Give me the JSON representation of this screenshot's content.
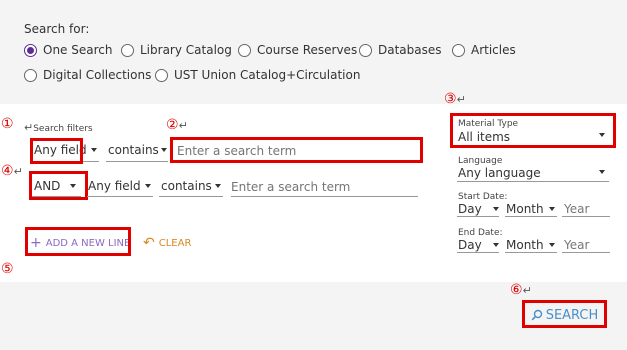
{
  "scope": {
    "title": "Search for:",
    "options": [
      {
        "label": "One Search",
        "selected": true
      },
      {
        "label": "Library Catalog",
        "selected": false
      },
      {
        "label": "Course Reserves",
        "selected": false
      },
      {
        "label": "Databases",
        "selected": false
      },
      {
        "label": "Articles",
        "selected": false
      },
      {
        "label": "Digital Collections",
        "selected": false
      },
      {
        "label": "UST Union Catalog+Circulation",
        "selected": false
      }
    ]
  },
  "markers": {
    "m1": "①",
    "m2": "②",
    "m3": "③",
    "m4": "④",
    "m5": "⑤",
    "m6": "⑥",
    "return_symbol": "↵"
  },
  "filters": {
    "label": "Search filters",
    "row1": {
      "field": "Any field",
      "operator": "contains",
      "placeholder": "Enter a search term"
    },
    "row2": {
      "boolean": "AND",
      "field": "Any field",
      "operator": "contains",
      "placeholder": "Enter a search term"
    },
    "add_line": "ADD A NEW LINE",
    "clear": "CLEAR"
  },
  "facets": {
    "material_type": {
      "label": "Material Type",
      "value": "All items"
    },
    "language": {
      "label": "Language",
      "value": "Any language"
    },
    "start_date": {
      "label": "Start Date:",
      "day": "Day",
      "month": "Month",
      "year": "Year"
    },
    "end_date": {
      "label": "End Date:",
      "day": "Day",
      "month": "Month",
      "year": "Year"
    }
  },
  "search_button": {
    "label": "SEARCH"
  },
  "colors": {
    "accent": "#5c2d91",
    "annotation": "#e00000",
    "search": "#4a90c8",
    "clear": "#d48a1f",
    "add_line": "#8a6ac0"
  }
}
